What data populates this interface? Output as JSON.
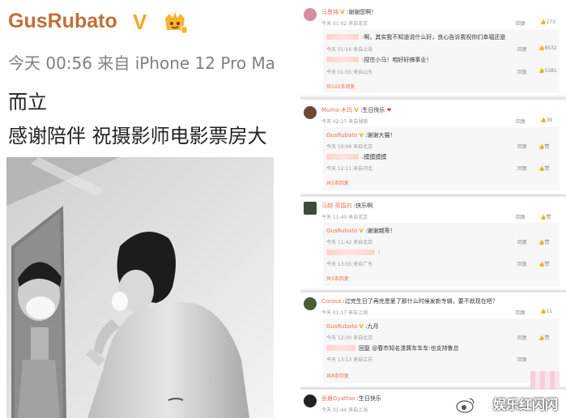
{
  "post": {
    "username": "GusRubato",
    "verified_mark": "V",
    "meta": "今天 00:56 来自 iPhone 12 Pro Ma",
    "line1": "而立",
    "line2": "感谢陪伴 祝摄影师电影票房大"
  },
  "comments": [
    {
      "name": "马思纯",
      "text": ":谢谢您啊！",
      "time": "今天 01:02 来自北京",
      "actions": "回复",
      "likes": "273",
      "replies": [
        {
          "name": "",
          "text": ":啊，其实我不知道说什么好，良心告诉我祝你们幸福还是",
          "time": "今天 01:16 来自上海",
          "actions": "回复",
          "likes": "8532"
        },
        {
          "name": "",
          "text": ":捏住小马！咱好好搞事业！",
          "time": "今天 01:05 来自山东",
          "actions": "回复",
          "likes": "5381"
        }
      ],
      "more": "共102条回复"
    },
    {
      "name": "Muma-木玛",
      "text": ":生日快乐",
      "time": "今天 02:17 来自湖南",
      "actions": "回复",
      "likes": "39",
      "replies": [
        {
          "name": "GusRubato",
          "text": ":谢谢大猫！",
          "time": "今天 10:06 来自北京",
          "actions": "回复",
          "likes": "赞"
        },
        {
          "name": "",
          "text": ":摸摸摸摸",
          "time": "今天 12:11 来自河北",
          "actions": "回复",
          "likes": "赞"
        }
      ],
      "more": "共5条回复"
    },
    {
      "name": "马越-英国的",
      "text": ":快乐啊",
      "time": "今天 11:40 来自北京",
      "actions": "回复",
      "likes": "赞",
      "replies": [
        {
          "name": "GusRubato",
          "text": ":谢谢越哥！",
          "time": "今天 11:42 来自北京",
          "actions": "回复",
          "likes": "赞"
        },
        {
          "name": "",
          "text": ":",
          "time": "今天 13:05 来自广东",
          "actions": "回复",
          "likes": "赞"
        }
      ],
      "more": "共3条回复"
    },
    {
      "name": "Corosa",
      "text": ":过完生日了再完恩爱了那什么时候发新专辑，要不就现在吧？",
      "time": "今天 01:17 来自上海",
      "actions": "回复",
      "likes": "11",
      "replies": [
        {
          "name": "GusRubato",
          "text": ":九月",
          "time": "今天 12:00 来自北京",
          "actions": "回复",
          "likes": "赞"
        },
        {
          "name": "",
          "text": "回复 @春市知名渣屑车车车:也支持鲁总",
          "time": "今天 13:13 来自江苏",
          "actions": "回复",
          "likes": "赞"
        }
      ],
      "more": "共8条回复"
    },
    {
      "name": "张悬Gyattso",
      "text": ":生日快乐",
      "time": "今天 01:44 来自上海",
      "actions": "回复",
      "likes": "",
      "replies": [],
      "more": ""
    }
  ],
  "watermark": "娱乐红闪闪"
}
